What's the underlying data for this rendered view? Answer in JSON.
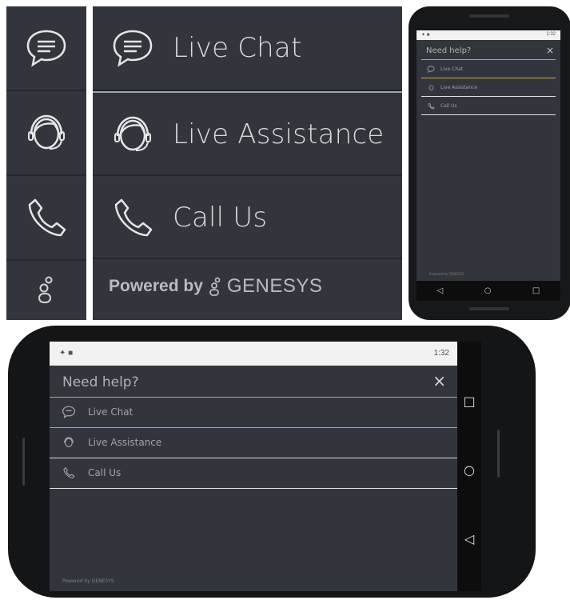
{
  "colors": {
    "background": "#32363c",
    "accent": "#c9a445",
    "divider": "#dfe3e6",
    "text": "#d9dadc"
  },
  "rail": {
    "icons": [
      "chat-bubble-icon",
      "headset-agent-icon",
      "phone-icon",
      "genesys-logo-icon"
    ]
  },
  "big_list": {
    "items": [
      {
        "label": "Live Chat",
        "icon": "chat-bubble-icon"
      },
      {
        "label": "Live Assistance",
        "icon": "headset-agent-icon"
      },
      {
        "label": "Call Us",
        "icon": "phone-icon"
      }
    ],
    "powered_by": "Powered by",
    "brand": "GENESYS"
  },
  "phone_portrait": {
    "title": "Need help?",
    "close": "×",
    "items": [
      "Live Chat",
      "Live Assistance",
      "Call Us"
    ],
    "status_time": "1:32",
    "footer": "Powered by GENESYS",
    "nav": [
      "◁",
      "○",
      "□"
    ]
  },
  "phone_landscape": {
    "title": "Need help?",
    "close": "×",
    "items": [
      "Live Chat",
      "Live Assistance",
      "Call Us"
    ],
    "status_time": "1:32",
    "footer": "Powered by GENESYS",
    "nav": [
      "□",
      "○",
      "◁"
    ]
  }
}
